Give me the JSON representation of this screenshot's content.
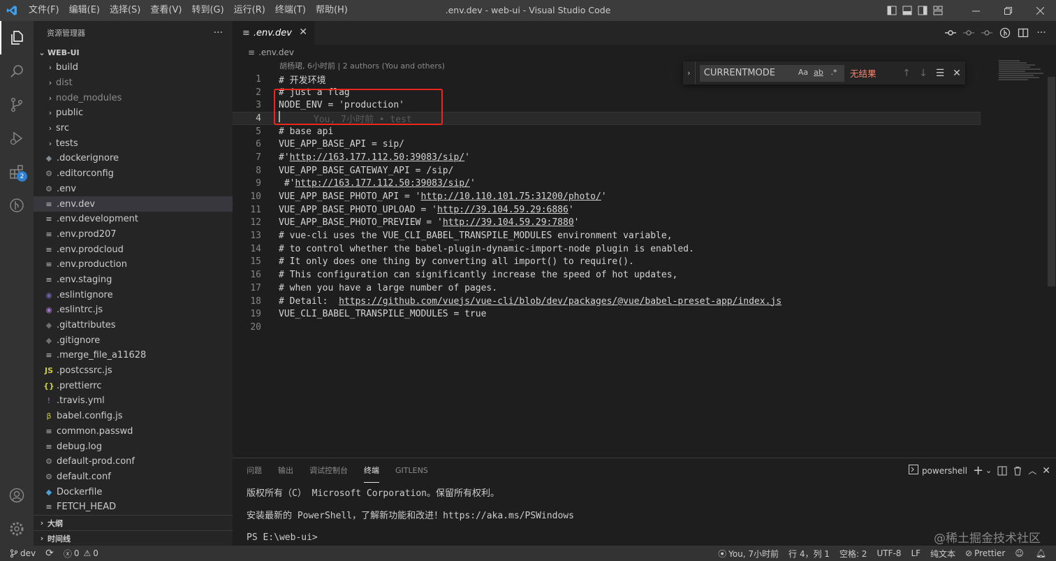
{
  "titlebar": {
    "menu": [
      "文件(F)",
      "编辑(E)",
      "选择(S)",
      "查看(V)",
      "转到(G)",
      "运行(R)",
      "终端(T)",
      "帮助(H)"
    ],
    "window_title": ".env.dev - web-ui - Visual Studio Code"
  },
  "activitybar": {
    "extensions_badge": "2"
  },
  "sidebar": {
    "title": "资源管理器",
    "more": "···",
    "root": "WEB-UI",
    "folders": [
      {
        "label": "build"
      },
      {
        "label": "dist"
      },
      {
        "label": "node_modules"
      },
      {
        "label": "public"
      },
      {
        "label": "src"
      },
      {
        "label": "tests"
      }
    ],
    "files": [
      {
        "label": ".dockerignore",
        "glyph": "◆",
        "color": "#7f8c96"
      },
      {
        "label": ".editorconfig",
        "glyph": "⚙",
        "color": "#9e9e9e"
      },
      {
        "label": ".env",
        "glyph": "⚙",
        "color": "#9e9e9e"
      },
      {
        "label": ".env.dev",
        "glyph": "≡",
        "color": "#c5c5c5"
      },
      {
        "label": ".env.development",
        "glyph": "≡",
        "color": "#c5c5c5"
      },
      {
        "label": ".env.prod207",
        "glyph": "≡",
        "color": "#c5c5c5"
      },
      {
        "label": ".env.prodcloud",
        "glyph": "≡",
        "color": "#c5c5c5"
      },
      {
        "label": ".env.production",
        "glyph": "≡",
        "color": "#c5c5c5"
      },
      {
        "label": ".env.staging",
        "glyph": "≡",
        "color": "#c5c5c5"
      },
      {
        "label": ".eslintignore",
        "glyph": "◉",
        "color": "#6b5f9e"
      },
      {
        "label": ".eslintrc.js",
        "glyph": "◉",
        "color": "#a074c4"
      },
      {
        "label": ".gitattributes",
        "glyph": "◆",
        "color": "#6f6f6f"
      },
      {
        "label": ".gitignore",
        "glyph": "◆",
        "color": "#6f6f6f"
      },
      {
        "label": ".merge_file_a11628",
        "glyph": "≡",
        "color": "#c5c5c5"
      },
      {
        "label": ".postcssrc.js",
        "glyph": "JS",
        "color": "#cbcb41"
      },
      {
        "label": ".prettierrc",
        "glyph": "{}",
        "color": "#cbcb41"
      },
      {
        "label": ".travis.yml",
        "glyph": "!",
        "color": "#a074c4"
      },
      {
        "label": "babel.config.js",
        "glyph": "β",
        "color": "#cbcb41"
      },
      {
        "label": "common.passwd",
        "glyph": "≡",
        "color": "#c5c5c5"
      },
      {
        "label": "debug.log",
        "glyph": "≡",
        "color": "#c5c5c5"
      },
      {
        "label": "default-prod.conf",
        "glyph": "⚙",
        "color": "#9e9e9e"
      },
      {
        "label": "default.conf",
        "glyph": "⚙",
        "color": "#9e9e9e"
      },
      {
        "label": "Dockerfile",
        "glyph": "◆",
        "color": "#4d9fd8"
      },
      {
        "label": "FETCH_HEAD",
        "glyph": "≡",
        "color": "#c5c5c5"
      }
    ],
    "outline": "大纲",
    "timeline": "时间线"
  },
  "editor": {
    "tab_label": ".env.dev",
    "tab_close": "✕",
    "breadcrumb": ".env.dev",
    "blame": "胡杨珺, 6小时前 | 2 authors (You and others)",
    "ghost_text": "You, 7小时前 • test",
    "lines": [
      {
        "n": "1",
        "text": "# 开发环境"
      },
      {
        "n": "2",
        "text": "# just a flag"
      },
      {
        "n": "3",
        "text": "NODE_ENV = 'production'"
      },
      {
        "n": "4",
        "text": ""
      },
      {
        "n": "5",
        "text": "# base api"
      },
      {
        "n": "6",
        "text": "VUE_APP_BASE_API = sip/"
      },
      {
        "n": "7",
        "pre": "#'",
        "url": "http://163.177.112.50:39083/sip/",
        "post": "'"
      },
      {
        "n": "8",
        "text": "VUE_APP_BASE_GATEWAY_API = /sip/"
      },
      {
        "n": "9",
        "pre": " #'",
        "url": "http://163.177.112.50:39083/sip/",
        "post": "'"
      },
      {
        "n": "10",
        "pre": "VUE_APP_BASE_PHOTO_API = '",
        "url": "http://10.110.101.75:31200/photo/",
        "post": "'"
      },
      {
        "n": "11",
        "pre": "VUE_APP_BASE_PHOTO_UPLOAD = '",
        "url": "http://39.104.59.29:6886",
        "post": "'"
      },
      {
        "n": "12",
        "pre": "VUE_APP_BASE_PHOTO_PREVIEW = '",
        "url": "http://39.104.59.29:7880",
        "post": "'"
      },
      {
        "n": "13",
        "text": "# vue-cli uses the VUE_CLI_BABEL_TRANSPILE_MODULES environment variable,"
      },
      {
        "n": "14",
        "text": "# to control whether the babel-plugin-dynamic-import-node plugin is enabled."
      },
      {
        "n": "15",
        "text": "# It only does one thing by converting all import() to require()."
      },
      {
        "n": "16",
        "text": "# This configuration can significantly increase the speed of hot updates,"
      },
      {
        "n": "17",
        "text": "# when you have a large number of pages."
      },
      {
        "n": "18",
        "pre": "# Detail:  ",
        "url": "https://github.com/vuejs/vue-cli/blob/dev/packages/@vue/babel-preset-app/index.js",
        "post": ""
      },
      {
        "n": "19",
        "text": "VUE_CLI_BABEL_TRANSPILE_MODULES = true"
      },
      {
        "n": "20",
        "text": ""
      }
    ]
  },
  "find": {
    "value": "CURRENTMODE",
    "opt_case": "Aa",
    "opt_word": "ab",
    "opt_regex": ".*",
    "no_results": "无结果",
    "prev": "↑",
    "next": "↓",
    "selection": "☰",
    "close": "✕"
  },
  "panel": {
    "tabs": [
      "问题",
      "输出",
      "调试控制台",
      "终端",
      "GITLENS"
    ],
    "active_tab": "终端",
    "shell": "powershell",
    "terminal_lines": [
      "版权所有（C） Microsoft Corporation。保留所有权利。",
      "安装最新的 PowerShell，了解新功能和改进！https://aka.ms/PSWindows",
      "PS E:\\web-ui>"
    ]
  },
  "statusbar": {
    "branch": "dev",
    "errors": "0",
    "warnings": "0",
    "blame": "You, 7小时前",
    "position": "行 4，列 1",
    "spaces": "空格: 2",
    "encoding": "UTF-8",
    "eol": "LF",
    "language": "纯文本",
    "prettier": "Prettier"
  },
  "watermark": "@稀土掘金技术社区"
}
